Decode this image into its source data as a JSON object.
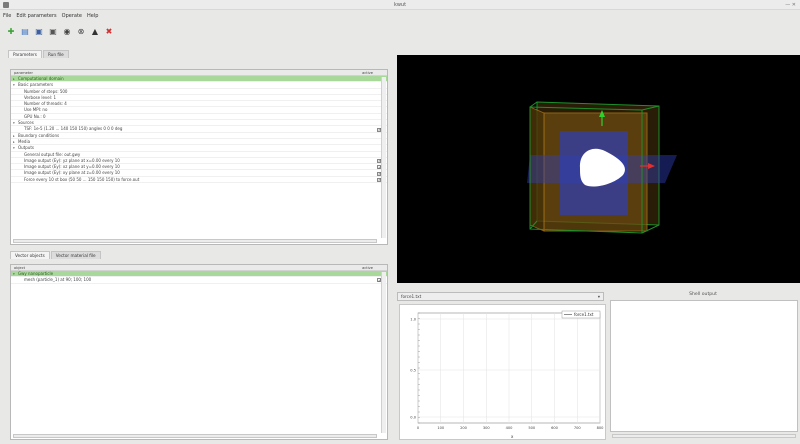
{
  "window": {
    "title": "kwut",
    "controls": "— ✕"
  },
  "menu": [
    "File",
    "Edit parameters",
    "Operate",
    "Help"
  ],
  "toolbar": [
    {
      "name": "new-icon",
      "glyph": "✚",
      "color": "#3aa335"
    },
    {
      "name": "open-icon",
      "glyph": "▤",
      "color": "#3b73c4"
    },
    {
      "name": "save-icon",
      "glyph": "▣",
      "color": "#3b5fa0"
    },
    {
      "name": "save-as-icon",
      "glyph": "▣",
      "color": "#555555"
    },
    {
      "name": "run-icon",
      "glyph": "◉",
      "color": "#444444"
    },
    {
      "name": "stop-icon",
      "glyph": "⊗",
      "color": "#444444"
    },
    {
      "name": "vehicle-icon",
      "glyph": "▲",
      "color": "#333333"
    },
    {
      "name": "exit-icon",
      "glyph": "✖",
      "color": "#d03030"
    }
  ],
  "top_tabs": [
    "Parameters",
    "Run file"
  ],
  "param_panel": {
    "col_parameter": "parameter",
    "col_active": "active",
    "rows": [
      {
        "text": "Computational domain",
        "indent": 0,
        "exp": "▸",
        "sel": true,
        "chk": false
      },
      {
        "text": "Basic parameters",
        "indent": 0,
        "exp": "▾",
        "sel": false,
        "chk": false
      },
      {
        "text": "Number of steps: 500",
        "indent": 2,
        "exp": "",
        "sel": false,
        "chk": false
      },
      {
        "text": "Verbose level: 1",
        "indent": 2,
        "exp": "",
        "sel": false,
        "chk": false
      },
      {
        "text": "Number of threads: 4",
        "indent": 2,
        "exp": "",
        "sel": false,
        "chk": false
      },
      {
        "text": "Use MPI: no",
        "indent": 2,
        "exp": "",
        "sel": false,
        "chk": false
      },
      {
        "text": "GPU No.: 0",
        "indent": 2,
        "exp": "",
        "sel": false,
        "chk": false
      },
      {
        "text": "Sources",
        "indent": 0,
        "exp": "▾",
        "sel": false,
        "chk": false
      },
      {
        "text": "TSF: 1e-5 (1.20 ... 140 150 150) angles 0 0 0 deg",
        "indent": 2,
        "exp": "",
        "sel": false,
        "chk": true
      },
      {
        "text": "Boundary conditions",
        "indent": 0,
        "exp": "▸",
        "sel": false,
        "chk": false
      },
      {
        "text": "Media",
        "indent": 0,
        "exp": "▸",
        "sel": false,
        "chk": false
      },
      {
        "text": "Outputs",
        "indent": 0,
        "exp": "▾",
        "sel": false,
        "chk": false
      },
      {
        "text": "General output file: out.gwy",
        "indent": 2,
        "exp": "",
        "sel": false,
        "chk": false
      },
      {
        "text": "Image output (Ey): yz plane at x=0.00 every 10",
        "indent": 2,
        "exp": "",
        "sel": false,
        "chk": true
      },
      {
        "text": "Image output (Ey): xz plane at y=0.00 every 10",
        "indent": 2,
        "exp": "",
        "sel": false,
        "chk": true
      },
      {
        "text": "Image output (Ey): xy plane at z=0.00 every 10",
        "indent": 2,
        "exp": "",
        "sel": false,
        "chk": true
      },
      {
        "text": "Force every 10 st box (50 50 ... 150 150 150) to force.out",
        "indent": 2,
        "exp": "",
        "sel": false,
        "chk": true
      }
    ]
  },
  "bottom_tabs": [
    "Vector objects",
    "Vector material file"
  ],
  "object_panel": {
    "col_object": "object",
    "col_active": "active",
    "rows": [
      {
        "text": "Gwy nanoparticle",
        "indent": 0,
        "exp": "▾",
        "sel": true,
        "chk": false
      },
      {
        "text": "mesh (particle_1) at 90; 100; 100",
        "indent": 2,
        "exp": "",
        "sel": false,
        "chk": true
      }
    ]
  },
  "plot": {
    "selector": "force1.txt",
    "arrow": "▾",
    "legend": "force1.txt",
    "xlabel": "x",
    "chart_data": {
      "type": "line",
      "title": "",
      "xlabel": "x",
      "ylabel": "",
      "x_ticks": [
        "0",
        "100",
        "200",
        "300",
        "400",
        "500",
        "600",
        "700",
        "800"
      ],
      "y_ticks": [
        "1.0",
        "0.5",
        "0.0"
      ],
      "xlim": [
        0,
        800
      ],
      "ylim": [
        0,
        1
      ],
      "grid": true,
      "legend_position": "top-right",
      "series": [
        {
          "name": "force1.txt",
          "x": [],
          "y": []
        }
      ]
    }
  },
  "output_label": "Shell output",
  "viewport": {
    "bg": "#000000",
    "axis_y_color": "#2ed12e",
    "axis_x_color": "#e03030",
    "box_color": "#b07a1a",
    "plane_color": "#2e3fb8",
    "grid_color": "#1f8f2a"
  }
}
